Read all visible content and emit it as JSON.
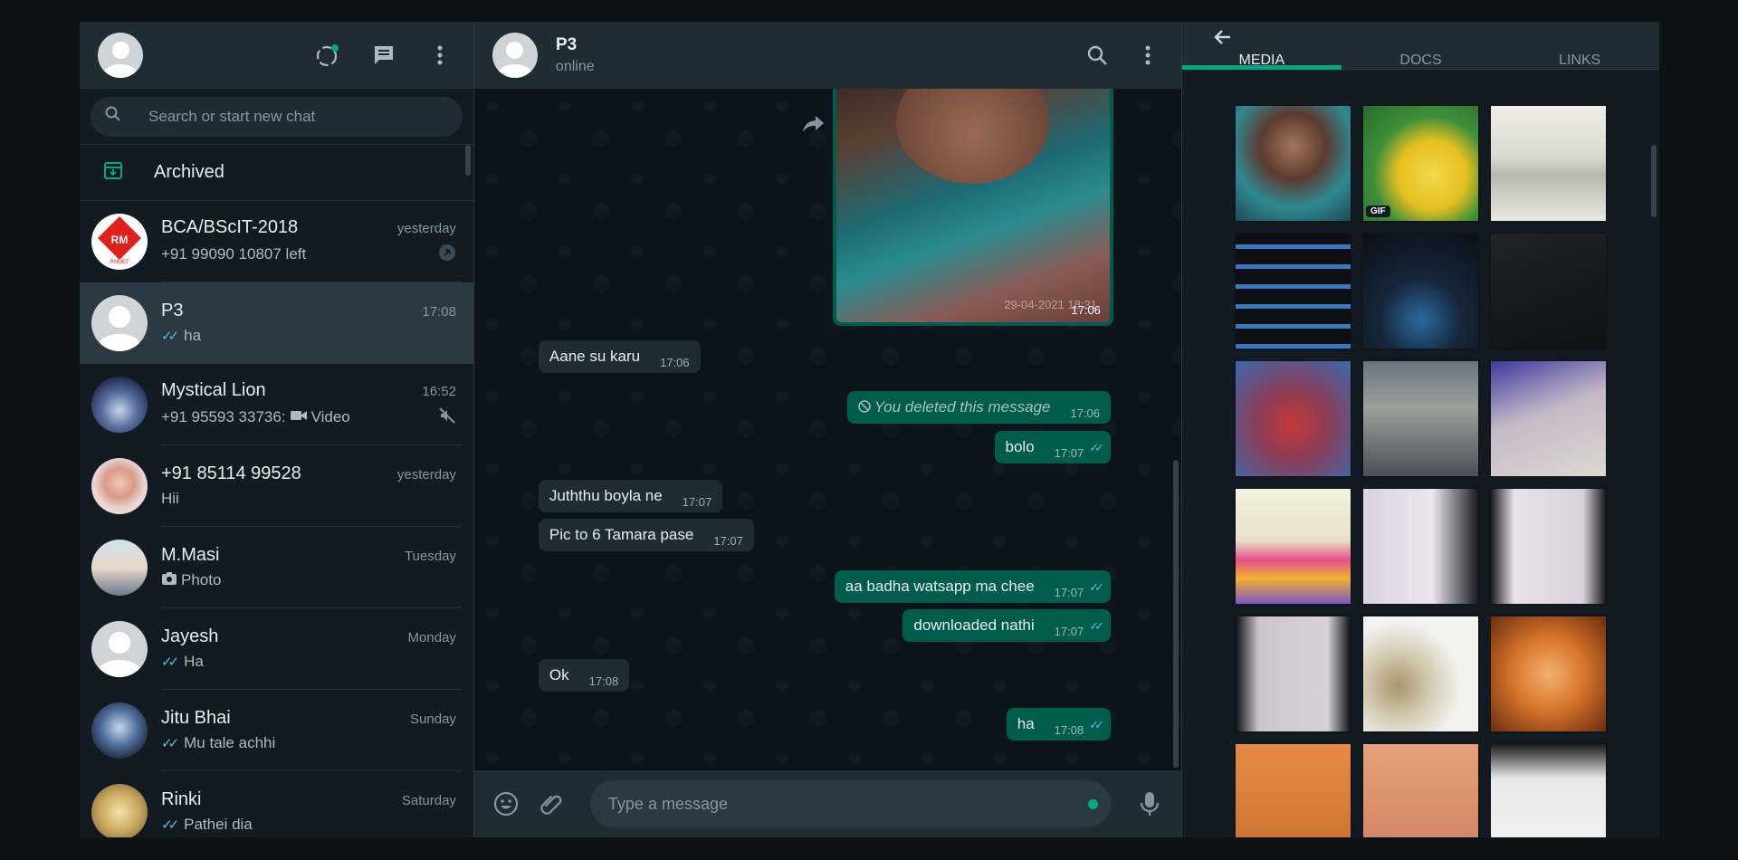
{
  "colors": {
    "accent": "#00a884",
    "outgoing": "#005c4b",
    "incoming": "#202c33",
    "tick": "#53bdeb"
  },
  "left": {
    "search_placeholder": "Search or start new chat",
    "archived_label": "Archived",
    "chats": [
      {
        "name": "BCA/BScIT-2018",
        "time": "yesterday",
        "preview": "+91 99090 10807 left",
        "icon": "pin-icon"
      },
      {
        "name": "P3",
        "time": "17:08",
        "preview": "ha",
        "ticks": "✓✓"
      },
      {
        "name": "Mystical Lion",
        "time": "16:52",
        "preview": "+91 95593 33736:",
        "preview_media": "Video",
        "icon": "muted-icon"
      },
      {
        "name": "+91 85114 99528",
        "time": "yesterday",
        "preview": "Hii"
      },
      {
        "name": "M.Masi",
        "time": "Tuesday",
        "preview": "Photo"
      },
      {
        "name": "Jayesh",
        "time": "Monday",
        "preview": "Ha",
        "ticks": "✓✓"
      },
      {
        "name": "Jitu Bhai",
        "time": "Sunday",
        "preview": "Mu tale achhi",
        "ticks": "✓✓"
      },
      {
        "name": "Rinki",
        "time": "Saturday",
        "preview": "Pathei dia",
        "ticks": "✓✓"
      }
    ]
  },
  "conversation": {
    "contact_name": "P3",
    "status": "online",
    "image_time": "17:06",
    "image_stamp": "29-04-2021 18:31",
    "messages": [
      {
        "dir": "in",
        "text": "Aane su karu",
        "time": "17:06"
      },
      {
        "dir": "out",
        "text": "You deleted this message",
        "time": "17:06",
        "deleted": true
      },
      {
        "dir": "out",
        "text": "bolo",
        "time": "17:07",
        "ticks": "✓✓"
      },
      {
        "dir": "in",
        "text": "Juththu boyla ne",
        "time": "17:07"
      },
      {
        "dir": "in",
        "text": "Pic to 6 Tamara pase",
        "time": "17:07"
      },
      {
        "dir": "out",
        "text": "aa badha watsapp ma chee",
        "time": "17:07",
        "ticks": "✓✓"
      },
      {
        "dir": "out",
        "text": "downloaded nathi",
        "time": "17:07",
        "ticks": "✓✓"
      },
      {
        "dir": "in",
        "text": "Ok",
        "time": "17:08"
      },
      {
        "dir": "out",
        "text": "ha",
        "time": "17:08",
        "ticks": "✓✓"
      }
    ],
    "input_placeholder": "Type a message"
  },
  "media_panel": {
    "tabs": [
      "MEDIA",
      "DOCS",
      "LINKS"
    ],
    "gif_badge": "GIF"
  }
}
